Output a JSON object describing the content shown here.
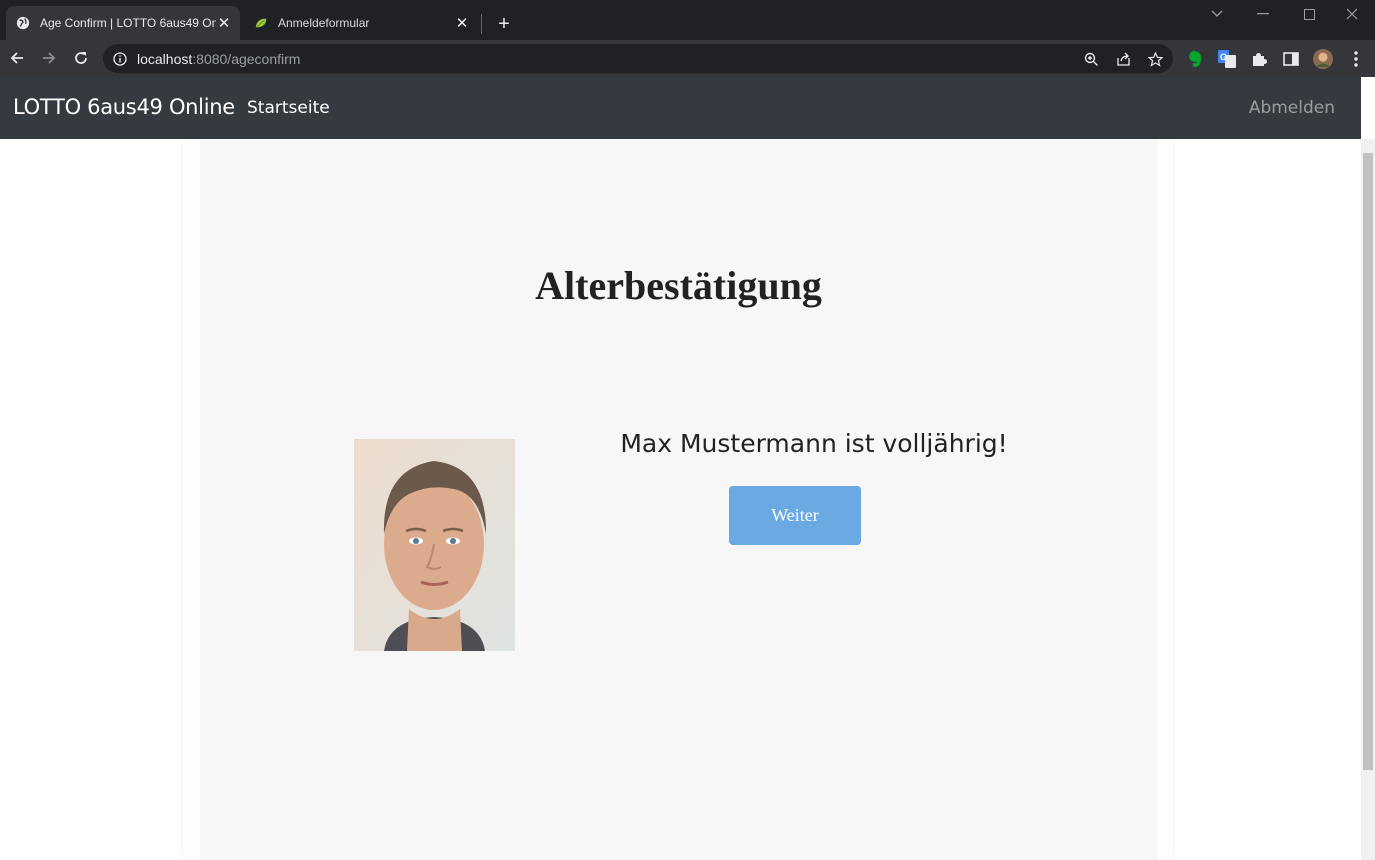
{
  "browser": {
    "tabs": [
      {
        "title": "Age Confirm | LOTTO 6aus49 Online",
        "active": true
      },
      {
        "title": "Anmeldeformular",
        "active": false
      }
    ],
    "url_host": "localhost",
    "url_rest": ":8080/ageconfirm"
  },
  "navbar": {
    "brand": "LOTTO 6aus49 Online",
    "home": "Startseite",
    "logout": "Abmelden"
  },
  "main": {
    "heading": "Alterbestätigung",
    "message": "Max Mustermann ist volljährig!",
    "button": "Weiter"
  },
  "colors": {
    "navbar_bg": "#343a40",
    "button_bg": "#6aa9e4",
    "card_bg": "#f7f7f7"
  }
}
